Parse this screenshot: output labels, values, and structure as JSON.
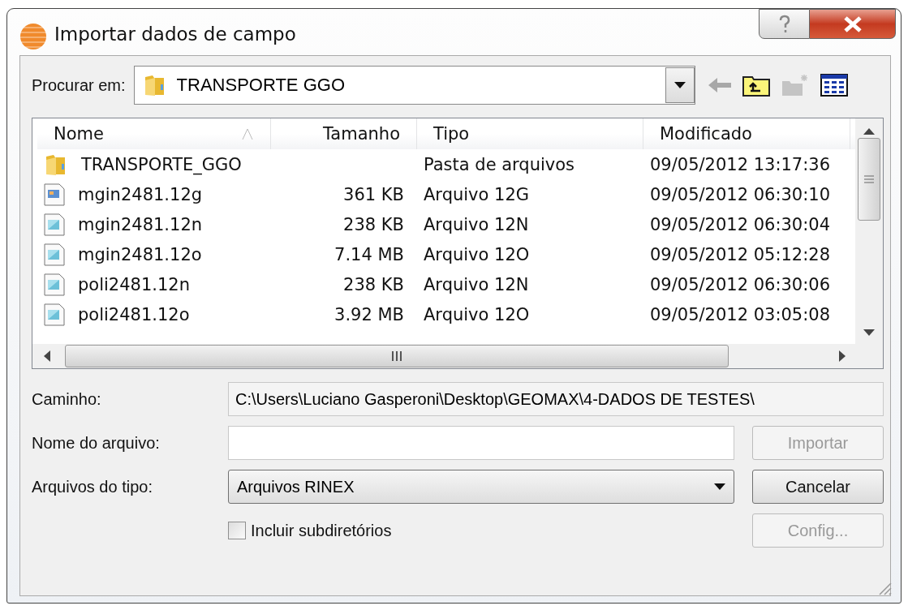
{
  "window": {
    "title": "Importar dados de campo"
  },
  "look_in": {
    "label": "Procurar em:",
    "value": "TRANSPORTE GGO"
  },
  "toolbar": [
    {
      "kind": "back",
      "disabled": true
    },
    {
      "kind": "up",
      "disabled": false
    },
    {
      "kind": "new-folder",
      "disabled": true
    },
    {
      "kind": "view",
      "disabled": false
    }
  ],
  "table": {
    "columns": [
      {
        "label": "Nome",
        "sorted": true
      },
      {
        "label": "Tamanho",
        "sorted": false
      },
      {
        "label": "Tipo",
        "sorted": false
      },
      {
        "label": "Modificado",
        "sorted": false
      }
    ],
    "rows": [
      {
        "kind": "folder",
        "name": "TRANSPORTE_GGO",
        "type": "Pasta de arquivos",
        "modified": "09/05/2012 13:17:36"
      },
      {
        "kind": "image-file",
        "name": "mgin2481.12g",
        "size": "361 KB",
        "type": "Arquivo 12G",
        "modified": "09/05/2012 06:30:10"
      },
      {
        "kind": "file",
        "name": "mgin2481.12n",
        "size": "238 KB",
        "type": "Arquivo 12N",
        "modified": "09/05/2012 06:30:04"
      },
      {
        "kind": "file",
        "name": "mgin2481.12o",
        "size": "7.14 MB",
        "type": "Arquivo 12O",
        "modified": "09/05/2012 05:12:28"
      },
      {
        "kind": "file",
        "name": "poli2481.12n",
        "size": "238 KB",
        "type": "Arquivo 12N",
        "modified": "09/05/2012 06:30:06"
      },
      {
        "kind": "file",
        "name": "poli2481.12o",
        "size": "3.92 MB",
        "type": "Arquivo 12O",
        "modified": "09/05/2012 03:05:08"
      }
    ]
  },
  "path": {
    "label": "Caminho:",
    "value": "C:\\Users\\Luciano Gasperoni\\Desktop\\GEOMAX\\4-DADOS DE TESTES\\"
  },
  "file_name": {
    "label": "Nome do arquivo:"
  },
  "file_type": {
    "label": "Arquivos do tipo:",
    "value": "Arquivos RINEX"
  },
  "include_subdirs": {
    "label": "Incluir subdiretórios",
    "checked": false
  },
  "buttons": [
    {
      "label": "Importar",
      "disabled": true
    },
    {
      "label": "Cancelar",
      "disabled": false
    },
    {
      "label": "Config...",
      "disabled": true
    }
  ]
}
